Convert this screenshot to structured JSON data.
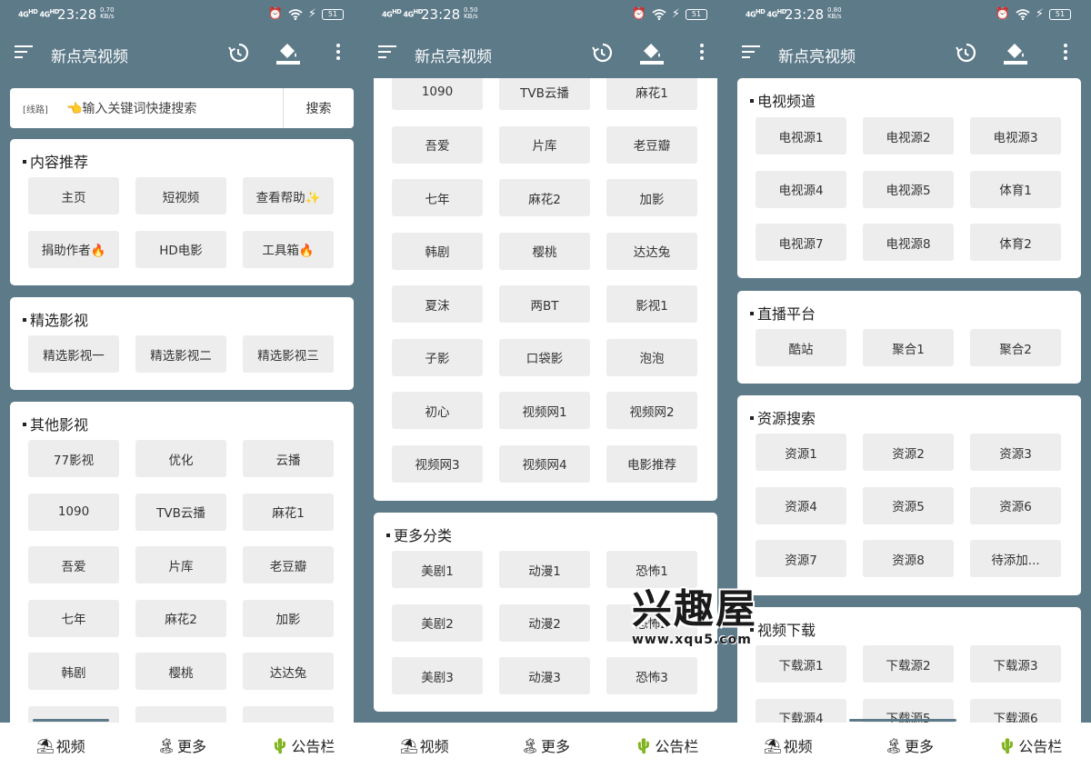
{
  "app": {
    "title": "新点亮视频"
  },
  "phones": [
    {
      "status": {
        "time": "23:28",
        "net": "4G 4G",
        "speed": "0.70",
        "speed_unit": "KB/s",
        "battery": "51"
      }
    },
    {
      "status": {
        "time": "23:28",
        "net": "4G 4G",
        "speed": "0.50",
        "speed_unit": "KB/s",
        "battery": "51"
      }
    },
    {
      "status": {
        "time": "23:28",
        "net": "4G 4G",
        "speed": "0.80",
        "speed_unit": "KB/s",
        "battery": "51"
      }
    }
  ],
  "search": {
    "tag": "[线路]",
    "placeholder": "👈输入关键词快捷搜索",
    "button": "搜索"
  },
  "screen1": {
    "content": {
      "title": "内容推荐",
      "items": [
        "主页",
        "短视频",
        "查看帮助✨",
        "捐助作者🔥",
        "HD电影",
        "工具箱🔥"
      ]
    },
    "featured": {
      "title": "精选影视",
      "items": [
        "精选影视一",
        "精选影视二",
        "精选影视三"
      ]
    },
    "other": {
      "title": "其他影视",
      "items": [
        "77影视",
        "优化",
        "云播",
        "1090",
        "TVB云播",
        "麻花1",
        "吾爱",
        "片库",
        "老豆瓣",
        "七年",
        "麻花2",
        "加影",
        "韩剧",
        "樱桃",
        "达达兔"
      ]
    }
  },
  "screen2": {
    "other_rest": [
      "1090",
      "TVB云播",
      "麻花1",
      "吾爱",
      "片库",
      "老豆瓣",
      "七年",
      "麻花2",
      "加影",
      "韩剧",
      "樱桃",
      "达达兔",
      "夏沫",
      "两BT",
      "影视1",
      "子影",
      "口袋影",
      "泡泡",
      "初心",
      "视频网1",
      "视频网2",
      "视频网3",
      "视频网4",
      "电影推荐"
    ],
    "more": {
      "title": "更多分类",
      "items": [
        "美剧1",
        "动漫1",
        "恐怖1",
        "美剧2",
        "动漫2",
        "恐怖2",
        "美剧3",
        "动漫3",
        "恐怖3"
      ]
    }
  },
  "screen3": {
    "tv": {
      "title": "电视频道",
      "items": [
        "电视源1",
        "电视源2",
        "电视源3",
        "电视源4",
        "电视源5",
        "体育1",
        "电视源7",
        "电视源8",
        "体育2"
      ]
    },
    "live": {
      "title": "直播平台",
      "items": [
        "酷站",
        "聚合1",
        "聚合2"
      ]
    },
    "res": {
      "title": "资源搜索",
      "items": [
        "资源1",
        "资源2",
        "资源3",
        "资源4",
        "资源5",
        "资源6",
        "资源7",
        "资源8",
        "待添加..."
      ]
    },
    "dl": {
      "title": "视频下载",
      "items": [
        "下载源1",
        "下载源2",
        "下载源3",
        "下载源4",
        "下载源5",
        "下载源6"
      ]
    }
  },
  "tabs": [
    "视频",
    "更多",
    "公告栏"
  ],
  "watermark": {
    "big": "兴趣屋",
    "url": "www.xqu5.com"
  }
}
